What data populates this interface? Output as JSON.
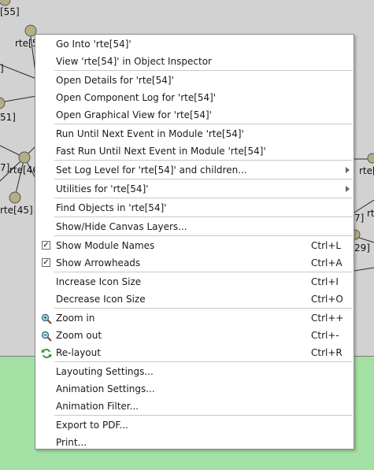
{
  "canvas": {
    "labels": [
      "[55]",
      "rte[5",
      "]",
      "51]",
      "7]",
      "rte[46",
      "rte[45]",
      "rte[",
      "rt",
      "7]",
      "29]"
    ]
  },
  "menu": {
    "items": [
      {
        "label": "Go Into 'rte[54]'"
      },
      {
        "label": "View 'rte[54]' in Object Inspector"
      },
      {
        "sep": true
      },
      {
        "label": "Open Details for 'rte[54]'"
      },
      {
        "label": "Open Component Log for 'rte[54]'"
      },
      {
        "label": "Open Graphical View for 'rte[54]'"
      },
      {
        "sep": true
      },
      {
        "label": "Run Until Next Event in Module 'rte[54]'"
      },
      {
        "label": "Fast Run Until Next Event in Module 'rte[54]'"
      },
      {
        "sep": true
      },
      {
        "label": "Set Log Level for 'rte[54]' and children...",
        "submenu": true
      },
      {
        "sep": true
      },
      {
        "label": "Utilities for 'rte[54]'",
        "submenu": true
      },
      {
        "sep": true
      },
      {
        "label": "Find Objects in 'rte[54]'"
      },
      {
        "sep": true
      },
      {
        "label": "Show/Hide Canvas Layers..."
      },
      {
        "sep": true
      },
      {
        "label": "Show Module Names",
        "shortcut": "Ctrl+L",
        "check": "✓"
      },
      {
        "label": "Show Arrowheads",
        "shortcut": "Ctrl+A",
        "check": "✓"
      },
      {
        "sep": true
      },
      {
        "label": "Increase Icon Size",
        "shortcut": "Ctrl+I"
      },
      {
        "label": "Decrease Icon Size",
        "shortcut": "Ctrl+O"
      },
      {
        "sep": true
      },
      {
        "label": "Zoom in",
        "shortcut": "Ctrl++",
        "icon": "zoom-in-icon"
      },
      {
        "label": "Zoom out",
        "shortcut": "Ctrl+-",
        "icon": "zoom-out-icon"
      },
      {
        "label": "Re-layout",
        "shortcut": "Ctrl+R",
        "icon": "relayout-icon"
      },
      {
        "sep": true
      },
      {
        "label": "Layouting Settings..."
      },
      {
        "label": "Animation Settings..."
      },
      {
        "label": "Animation Filter..."
      },
      {
        "sep": true
      },
      {
        "label": "Export to PDF..."
      },
      {
        "label": "Print..."
      }
    ]
  }
}
